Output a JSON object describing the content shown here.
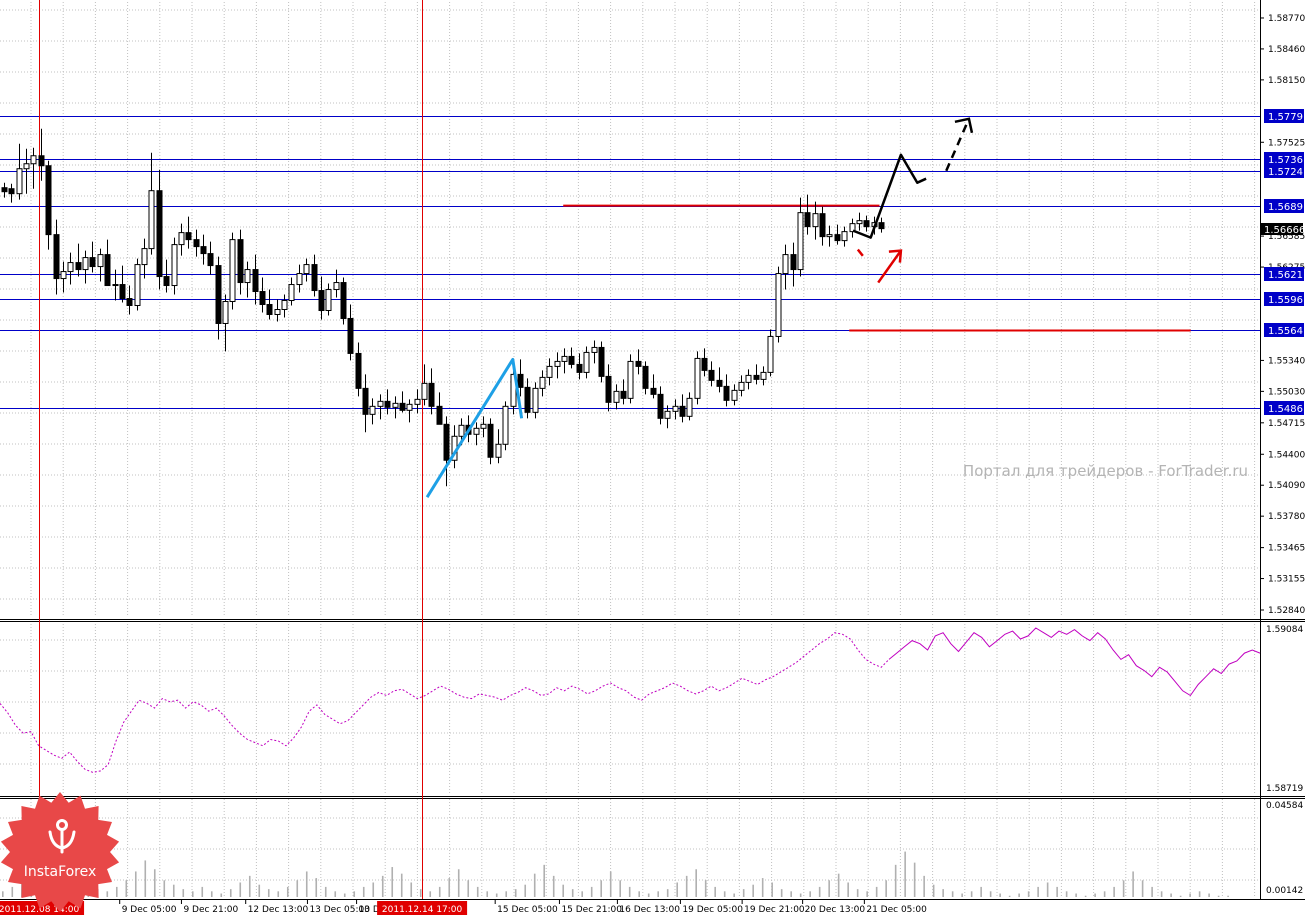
{
  "chart_data": {
    "type": "candlestick",
    "colors": {
      "background": "#ffffff",
      "grid": "#c0c0c0",
      "candle": "#000000",
      "level_line": "#0000c8",
      "level_label_bg": "#0000c8",
      "current_price_bg": "#000000",
      "vertical_marker": "#e00000",
      "red_line": "#e00000",
      "trend_line": "#1ea0e6",
      "oscillator": "#c000c0",
      "volume": "#b0b0b0",
      "timestamp_highlight": "#e00000"
    },
    "price_axis": {
      "ylim": [
        1.5277,
        1.5893
      ],
      "ticks": [
        "1.58770",
        "1.58460",
        "1.58150",
        "1.57525",
        "1.56585",
        "1.56275",
        "1.55340",
        "1.55030",
        "1.54715",
        "1.54400",
        "1.54090",
        "1.53780",
        "1.53465",
        "1.53155",
        "1.52840"
      ]
    },
    "levels": [
      {
        "price": 1.5779,
        "label": "1.5779"
      },
      {
        "price": 1.5736,
        "label": "1.5736"
      },
      {
        "price": 1.5724,
        "label": "1.5724"
      },
      {
        "price": 1.5689,
        "label": "1.5689"
      },
      {
        "price": 1.5621,
        "label": "1.5621"
      },
      {
        "price": 1.5596,
        "label": "1.5596"
      },
      {
        "price": 1.5564,
        "label": "1.5564"
      },
      {
        "price": 1.5486,
        "label": "1.5486"
      }
    ],
    "current_price": {
      "price": 1.5666,
      "label": "1.56666"
    },
    "red_segments": [
      {
        "x_start": 0.447,
        "x_end": 0.698,
        "price": 1.5689
      },
      {
        "x_start": 0.674,
        "x_end": 0.945,
        "price": 1.5564
      }
    ],
    "vertical_markers": [
      0.031,
      0.335
    ],
    "trend_line": [
      [
        0.339,
        1.5397
      ],
      [
        0.407,
        1.5535
      ],
      [
        0.414,
        1.5476
      ]
    ],
    "forecast_black": [
      [
        0.677,
        1.5664
      ],
      [
        0.691,
        1.5657
      ],
      [
        0.715,
        1.574
      ],
      [
        0.728,
        1.5712
      ],
      [
        0.735,
        1.5716
      ]
    ],
    "forecast_black_dashed": [
      [
        0.751,
        1.5724
      ],
      [
        0.769,
        1.5776
      ]
    ],
    "forecast_red": [
      [
        0.684,
        1.5635
      ],
      [
        0.697,
        1.5612
      ],
      [
        0.715,
        1.5644
      ]
    ],
    "candles": [
      [
        1.5707,
        1.5712,
        1.5697,
        1.5703
      ],
      [
        1.5706,
        1.5711,
        1.5692,
        1.5701
      ],
      [
        1.5701,
        1.5751,
        1.5695,
        1.5726
      ],
      [
        1.5726,
        1.5746,
        1.5701,
        1.5731
      ],
      [
        1.5731,
        1.5747,
        1.5706,
        1.5739
      ],
      [
        1.5739,
        1.5766,
        1.5714,
        1.5729
      ],
      [
        1.5729,
        1.5734,
        1.5645,
        1.566
      ],
      [
        1.566,
        1.5675,
        1.56,
        1.5616
      ],
      [
        1.5616,
        1.5633,
        1.5602,
        1.5623
      ],
      [
        1.5623,
        1.5642,
        1.561,
        1.5632
      ],
      [
        1.5632,
        1.5651,
        1.5618,
        1.5625
      ],
      [
        1.5625,
        1.5644,
        1.5611,
        1.5637
      ],
      [
        1.5637,
        1.5653,
        1.5622,
        1.5628
      ],
      [
        1.5628,
        1.5646,
        1.5613,
        1.564
      ],
      [
        1.564,
        1.5655,
        1.5626,
        1.5609
      ],
      [
        1.5609,
        1.5625,
        1.5594,
        1.561
      ],
      [
        1.561,
        1.5629,
        1.5592,
        1.5596
      ],
      [
        1.5596,
        1.5609,
        1.558,
        1.5589
      ],
      [
        1.5589,
        1.5636,
        1.5584,
        1.563
      ],
      [
        1.563,
        1.5656,
        1.5616,
        1.5646
      ],
      [
        1.5646,
        1.5742,
        1.564,
        1.5704
      ],
      [
        1.5704,
        1.5725,
        1.5605,
        1.5618
      ],
      [
        1.5618,
        1.5635,
        1.5602,
        1.5609
      ],
      [
        1.5609,
        1.5657,
        1.56,
        1.565
      ],
      [
        1.565,
        1.5671,
        1.5639,
        1.5662
      ],
      [
        1.5662,
        1.5678,
        1.5646,
        1.5655
      ],
      [
        1.5655,
        1.5665,
        1.5638,
        1.5648
      ],
      [
        1.5648,
        1.566,
        1.563,
        1.5641
      ],
      [
        1.5641,
        1.5653,
        1.562,
        1.5629
      ],
      [
        1.5629,
        1.5638,
        1.5555,
        1.5571
      ],
      [
        1.5571,
        1.56,
        1.5543,
        1.5593
      ],
      [
        1.5593,
        1.5662,
        1.5585,
        1.5655
      ],
      [
        1.5655,
        1.5665,
        1.56,
        1.5612
      ],
      [
        1.5612,
        1.5633,
        1.5597,
        1.5625
      ],
      [
        1.5625,
        1.564,
        1.559,
        1.5603
      ],
      [
        1.5603,
        1.5617,
        1.5582,
        1.559
      ],
      [
        1.559,
        1.5605,
        1.5575,
        1.558
      ],
      [
        1.558,
        1.5595,
        1.5573,
        1.5585
      ],
      [
        1.5585,
        1.56,
        1.5577,
        1.5594
      ],
      [
        1.5594,
        1.5617,
        1.5589,
        1.561
      ],
      [
        1.561,
        1.563,
        1.5602,
        1.5621
      ],
      [
        1.5621,
        1.5636,
        1.5613,
        1.563
      ],
      [
        1.563,
        1.564,
        1.5598,
        1.5604
      ],
      [
        1.5604,
        1.5618,
        1.5575,
        1.5584
      ],
      [
        1.5584,
        1.5611,
        1.5579,
        1.5605
      ],
      [
        1.5605,
        1.5625,
        1.5597,
        1.5612
      ],
      [
        1.5612,
        1.5617,
        1.557,
        1.5576
      ],
      [
        1.5576,
        1.559,
        1.5534,
        1.5541
      ],
      [
        1.5541,
        1.5552,
        1.5498,
        1.5506
      ],
      [
        1.5506,
        1.552,
        1.5462,
        1.548
      ],
      [
        1.548,
        1.5496,
        1.547,
        1.5488
      ],
      [
        1.5488,
        1.55,
        1.5475,
        1.5493
      ],
      [
        1.5493,
        1.5505,
        1.548,
        1.5487
      ],
      [
        1.5487,
        1.5498,
        1.5476,
        1.5491
      ],
      [
        1.5491,
        1.5503,
        1.5482,
        1.5484
      ],
      [
        1.5484,
        1.5495,
        1.5472,
        1.549
      ],
      [
        1.549,
        1.5505,
        1.5481,
        1.5495
      ],
      [
        1.5495,
        1.553,
        1.5489,
        1.5511
      ],
      [
        1.5511,
        1.5526,
        1.548,
        1.5488
      ],
      [
        1.5488,
        1.5502,
        1.547,
        1.547
      ],
      [
        1.547,
        1.5478,
        1.5408,
        1.5434
      ],
      [
        1.5434,
        1.5469,
        1.5426,
        1.5458
      ],
      [
        1.5458,
        1.5476,
        1.5449,
        1.5469
      ],
      [
        1.5469,
        1.5479,
        1.5452,
        1.546
      ],
      [
        1.546,
        1.5472,
        1.5449,
        1.5466
      ],
      [
        1.5466,
        1.5478,
        1.5457,
        1.547
      ],
      [
        1.547,
        1.5476,
        1.543,
        1.5437
      ],
      [
        1.5437,
        1.5465,
        1.5431,
        1.545
      ],
      [
        1.545,
        1.5493,
        1.5444,
        1.5488
      ],
      [
        1.5488,
        1.5531,
        1.548,
        1.552
      ],
      [
        1.552,
        1.5535,
        1.5498,
        1.5507
      ],
      [
        1.5507,
        1.5516,
        1.5476,
        1.5482
      ],
      [
        1.5482,
        1.5512,
        1.5476,
        1.5506
      ],
      [
        1.5506,
        1.5524,
        1.5498,
        1.5517
      ],
      [
        1.5517,
        1.5536,
        1.5509,
        1.5528
      ],
      [
        1.5528,
        1.5542,
        1.5516,
        1.5533
      ],
      [
        1.5533,
        1.5546,
        1.5521,
        1.5538
      ],
      [
        1.5538,
        1.5547,
        1.5526,
        1.553
      ],
      [
        1.553,
        1.5541,
        1.5515,
        1.5522
      ],
      [
        1.5522,
        1.5548,
        1.5516,
        1.5542
      ],
      [
        1.5542,
        1.5554,
        1.5531,
        1.5547
      ],
      [
        1.5547,
        1.5553,
        1.5512,
        1.5518
      ],
      [
        1.5518,
        1.553,
        1.5483,
        1.5492
      ],
      [
        1.5492,
        1.551,
        1.5485,
        1.5503
      ],
      [
        1.5503,
        1.5515,
        1.549,
        1.5496
      ],
      [
        1.5496,
        1.554,
        1.5491,
        1.5533
      ],
      [
        1.5533,
        1.5545,
        1.552,
        1.5528
      ],
      [
        1.5528,
        1.5533,
        1.55,
        1.5506
      ],
      [
        1.5506,
        1.552,
        1.5496,
        1.55
      ],
      [
        1.55,
        1.5508,
        1.547,
        1.5476
      ],
      [
        1.5476,
        1.5489,
        1.5466,
        1.5483
      ],
      [
        1.5483,
        1.5495,
        1.5475,
        1.5488
      ],
      [
        1.5488,
        1.55,
        1.5472,
        1.5478
      ],
      [
        1.5478,
        1.5502,
        1.5474,
        1.5496
      ],
      [
        1.5496,
        1.5543,
        1.549,
        1.5536
      ],
      [
        1.5536,
        1.5546,
        1.5518,
        1.5524
      ],
      [
        1.5524,
        1.5533,
        1.5508,
        1.5514
      ],
      [
        1.5514,
        1.5527,
        1.5502,
        1.5508
      ],
      [
        1.5508,
        1.552,
        1.5488,
        1.5494
      ],
      [
        1.5494,
        1.551,
        1.5489,
        1.5504
      ],
      [
        1.5504,
        1.5519,
        1.5498,
        1.5512
      ],
      [
        1.5512,
        1.5525,
        1.5505,
        1.5519
      ],
      [
        1.5519,
        1.553,
        1.551,
        1.5515
      ],
      [
        1.5515,
        1.5528,
        1.5509,
        1.5522
      ],
      [
        1.5522,
        1.5565,
        1.5518,
        1.5558
      ],
      [
        1.5558,
        1.5628,
        1.5552,
        1.5621
      ],
      [
        1.5621,
        1.565,
        1.5605,
        1.564
      ],
      [
        1.564,
        1.5652,
        1.5608,
        1.5625
      ],
      [
        1.5625,
        1.5697,
        1.5618,
        1.5682
      ],
      [
        1.5682,
        1.57,
        1.566,
        1.5668
      ],
      [
        1.5668,
        1.5693,
        1.5655,
        1.5681
      ],
      [
        1.5681,
        1.5688,
        1.5649,
        1.5658
      ],
      [
        1.5658,
        1.5669,
        1.5648,
        1.566
      ],
      [
        1.566,
        1.567,
        1.565,
        1.5654
      ],
      [
        1.5654,
        1.5668,
        1.5648,
        1.5663
      ],
      [
        1.5663,
        1.5676,
        1.5657,
        1.5671
      ],
      [
        1.5671,
        1.5682,
        1.5664,
        1.5674
      ],
      [
        1.5674,
        1.5679,
        1.5663,
        1.5668
      ],
      [
        1.5668,
        1.5678,
        1.566,
        1.5672
      ],
      [
        1.5672,
        1.5677,
        1.5662,
        1.5666
      ]
    ],
    "oscillator": {
      "ylim": [
        1.58719,
        1.59084
      ],
      "ticks": [
        "1.59084",
        "1.58719"
      ],
      "values": [
        0.52,
        0.46,
        0.38,
        0.33,
        0.34,
        0.25,
        0.22,
        0.19,
        0.17,
        0.21,
        0.15,
        0.1,
        0.08,
        0.09,
        0.13,
        0.28,
        0.4,
        0.47,
        0.54,
        0.52,
        0.49,
        0.55,
        0.53,
        0.54,
        0.49,
        0.53,
        0.51,
        0.47,
        0.49,
        0.44,
        0.38,
        0.33,
        0.29,
        0.27,
        0.25,
        0.29,
        0.28,
        0.25,
        0.3,
        0.37,
        0.47,
        0.51,
        0.45,
        0.42,
        0.39,
        0.41,
        0.46,
        0.51,
        0.56,
        0.59,
        0.57,
        0.6,
        0.61,
        0.58,
        0.55,
        0.57,
        0.6,
        0.63,
        0.61,
        0.58,
        0.56,
        0.55,
        0.58,
        0.57,
        0.56,
        0.54,
        0.57,
        0.59,
        0.62,
        0.6,
        0.57,
        0.58,
        0.62,
        0.6,
        0.63,
        0.61,
        0.58,
        0.6,
        0.63,
        0.65,
        0.62,
        0.6,
        0.56,
        0.54,
        0.58,
        0.6,
        0.62,
        0.65,
        0.63,
        0.6,
        0.58,
        0.6,
        0.63,
        0.6,
        0.62,
        0.65,
        0.68,
        0.66,
        0.64,
        0.67,
        0.69,
        0.72,
        0.75,
        0.78,
        0.82,
        0.86,
        0.9,
        0.93,
        0.97,
        0.96,
        0.93,
        0.86,
        0.8,
        0.77,
        0.75,
        0.8,
        0.84,
        0.88,
        0.92,
        0.9,
        0.86,
        0.95,
        0.97,
        0.9,
        0.85,
        0.91,
        0.97,
        0.94,
        0.88,
        0.92,
        0.96,
        0.98,
        0.93,
        0.95,
        1.0,
        0.97,
        0.94,
        0.98,
        0.96,
        0.99,
        0.95,
        0.92,
        0.97,
        0.93,
        0.86,
        0.8,
        0.83,
        0.76,
        0.73,
        0.69,
        0.75,
        0.72,
        0.66,
        0.6,
        0.57,
        0.64,
        0.69,
        0.74,
        0.71,
        0.77,
        0.79,
        0.84,
        0.86,
        0.84
      ]
    },
    "volume": {
      "ylim": [
        0.00142,
        0.04584
      ],
      "ticks": [
        "0.04584",
        "0.00142"
      ],
      "values": [
        0.004,
        0.006,
        0.009,
        0.012,
        0.008,
        0.006,
        0.01,
        0.016,
        0.012,
        0.008,
        0.005,
        0.004,
        0.006,
        0.009,
        0.013,
        0.018,
        0.014,
        0.009,
        0.007,
        0.005,
        0.004,
        0.006,
        0.004,
        0.003,
        0.005,
        0.008,
        0.011,
        0.007,
        0.005,
        0.004,
        0.006,
        0.009,
        0.013,
        0.01,
        0.006,
        0.004,
        0.003,
        0.004,
        0.006,
        0.008,
        0.011,
        0.015,
        0.012,
        0.008,
        0.005,
        0.004,
        0.006,
        0.01,
        0.014,
        0.009,
        0.006,
        0.004,
        0.003,
        0.004,
        0.005,
        0.007,
        0.012,
        0.016,
        0.011,
        0.007,
        0.005,
        0.004,
        0.006,
        0.009,
        0.013,
        0.009,
        0.006,
        0.004,
        0.003,
        0.004,
        0.005,
        0.008,
        0.011,
        0.014,
        0.009,
        0.006,
        0.004,
        0.003,
        0.005,
        0.007,
        0.01,
        0.008,
        0.005,
        0.004,
        0.003,
        0.004,
        0.006,
        0.009,
        0.012,
        0.008,
        0.005,
        0.004,
        0.006,
        0.009,
        0.016,
        0.022,
        0.017,
        0.011,
        0.007,
        0.005,
        0.004,
        0.003,
        0.004,
        0.006,
        0.004,
        0.003,
        0.002,
        0.003,
        0.004,
        0.006,
        0.008,
        0.006,
        0.004,
        0.003,
        0.002,
        0.003,
        0.004,
        0.006,
        0.009,
        0.013,
        0.009,
        0.006,
        0.004,
        0.003,
        0.002,
        0.003,
        0.004,
        0.003,
        0.002,
        0.002
      ]
    },
    "time_axis": {
      "labels": [
        {
          "text": "2011.12.08 14:00",
          "pos": 0.031,
          "highlight": true
        },
        {
          "text": "9 Dec 05:00",
          "pos": 0.095,
          "highlight": false
        },
        {
          "text": "9 Dec 21:00",
          "pos": 0.144,
          "highlight": false
        },
        {
          "text": "12 Dec 13:00",
          "pos": 0.195,
          "highlight": false
        },
        {
          "text": "13 Dec 05:00",
          "pos": 0.244,
          "highlight": false
        },
        {
          "text": "13 Dec",
          "pos": 0.283,
          "highlight": false
        },
        {
          "text": "2011.12.14 17:00",
          "pos": 0.335,
          "highlight": true
        },
        {
          "text": "15 Dec 05:00",
          "pos": 0.393,
          "highlight": false
        },
        {
          "text": "15 Dec 21:00",
          "pos": 0.444,
          "highlight": false
        },
        {
          "text": "16 Dec 13:00",
          "pos": 0.49,
          "highlight": false
        },
        {
          "text": "19 Dec 05:00",
          "pos": 0.54,
          "highlight": false
        },
        {
          "text": "19 Dec 21:00",
          "pos": 0.589,
          "highlight": false
        },
        {
          "text": "20 Dec 13:00",
          "pos": 0.637,
          "highlight": false
        },
        {
          "text": "21 Dec 05:00",
          "pos": 0.686,
          "highlight": false
        }
      ]
    },
    "watermark": "Портал для трейдеров - ForTrader.ru",
    "logo": "InstaForex"
  }
}
